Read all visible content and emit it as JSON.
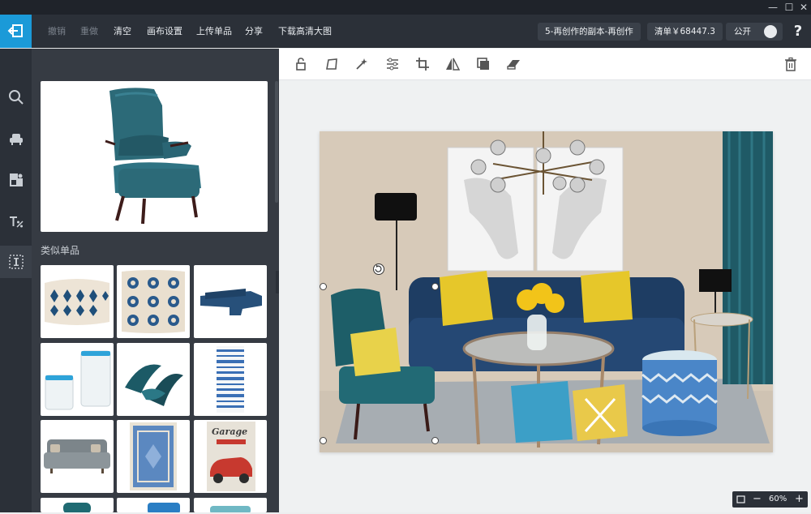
{
  "window": {
    "minimize": "—",
    "maximize": "☐",
    "close": "✕"
  },
  "toolbar": {
    "undo": "撤销",
    "redo": "重做",
    "clear": "清空",
    "canvas_settings": "画布设置",
    "upload_item": "上传单品",
    "share": "分享",
    "download_hd": "下载高清大图",
    "project_title": "5-再创作的副本-再创作",
    "price_list": "清单￥68447.3",
    "public_label": "公开",
    "help": "?"
  },
  "sidebar": {
    "items": [
      {
        "icon": "search-icon"
      },
      {
        "icon": "armchair-icon"
      },
      {
        "icon": "decor-icon"
      },
      {
        "icon": "text-icon"
      },
      {
        "icon": "selection-icon"
      }
    ]
  },
  "panel": {
    "similar_title": "类似单品"
  },
  "edit_tools": [
    {
      "icon": "unlock-icon"
    },
    {
      "icon": "distort-icon"
    },
    {
      "icon": "magic-wand-icon"
    },
    {
      "icon": "adjust-icon"
    },
    {
      "icon": "crop-icon"
    },
    {
      "icon": "flip-icon"
    },
    {
      "icon": "layer-icon"
    },
    {
      "icon": "eraser-icon"
    },
    {
      "icon": "trash-icon"
    }
  ],
  "zoom": {
    "minus": "−",
    "level": "60%",
    "plus": "+"
  },
  "colors": {
    "accent": "#1b9ad8",
    "topbar": "#2b3038",
    "panel": "#363b43"
  }
}
